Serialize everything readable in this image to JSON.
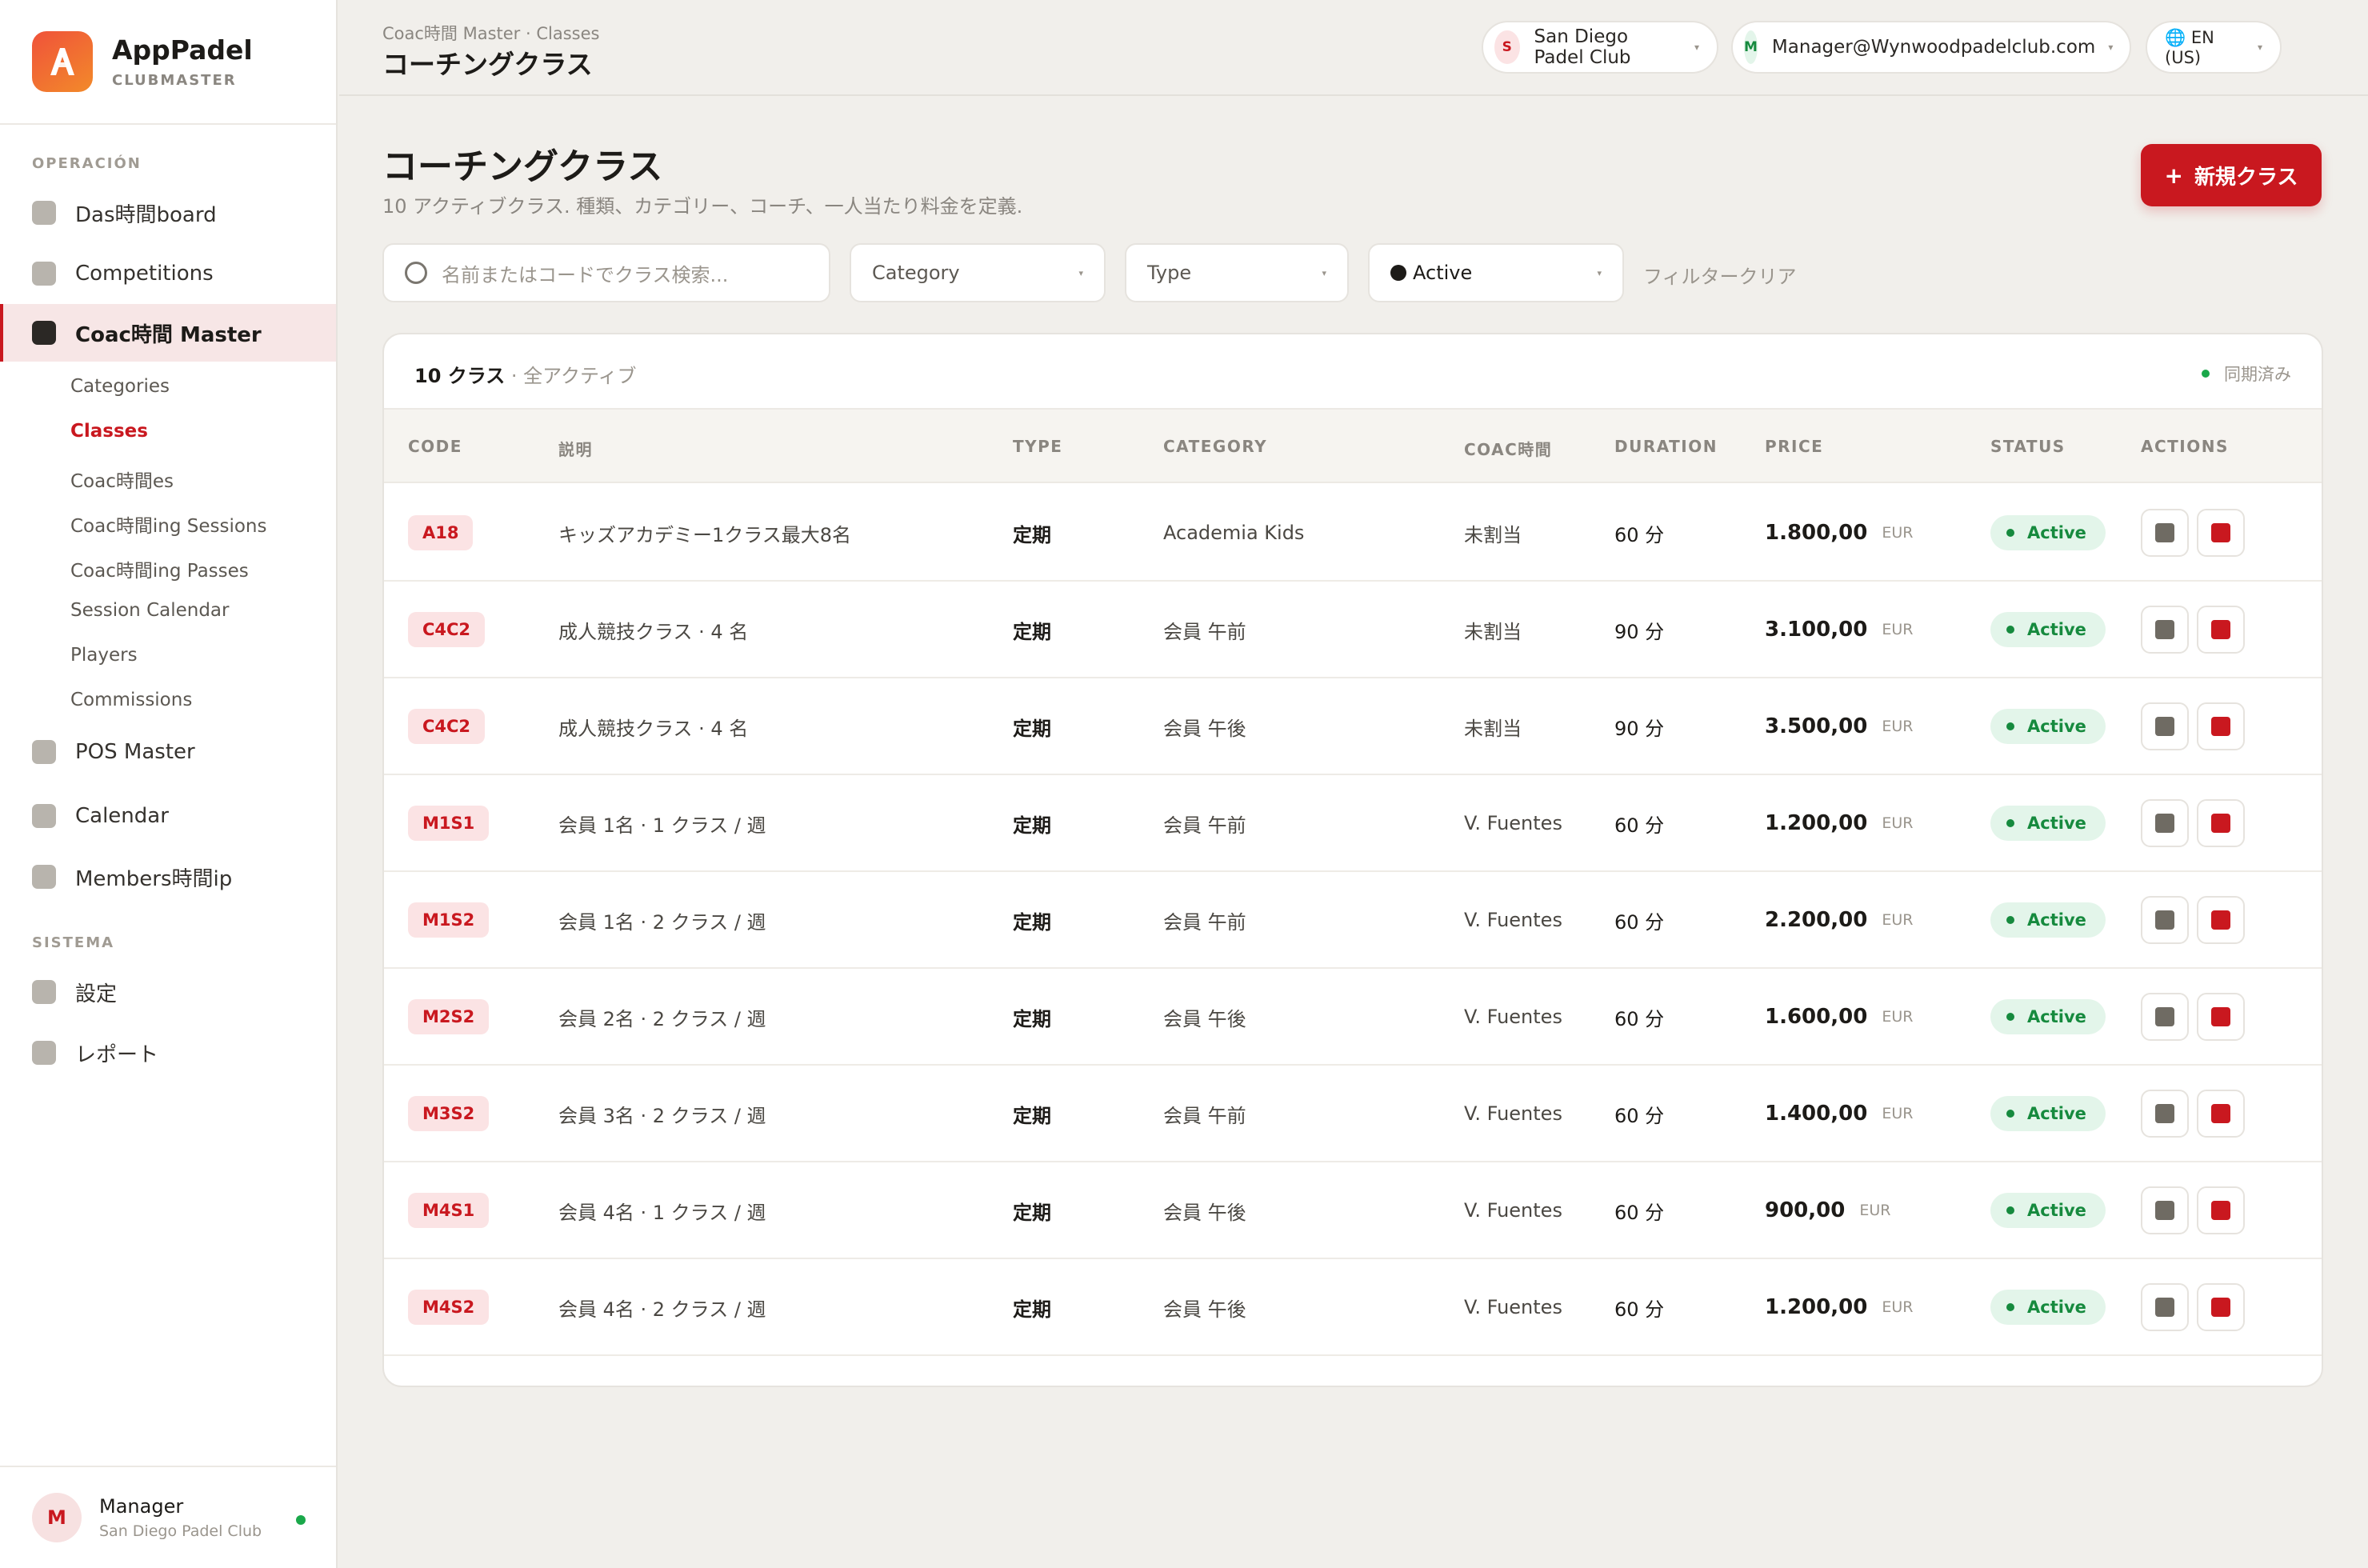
{
  "brand": {
    "name": "AppPadel",
    "sub": "CLUBMASTER"
  },
  "sidebar": {
    "section_operation": "OPERACIÓN",
    "section_system": "SISTEMA",
    "items": [
      {
        "label": "Das時間board"
      },
      {
        "label": "Competitions"
      },
      {
        "label": "Coac時間 Master"
      },
      {
        "label": "POS Master"
      },
      {
        "label": "Calendar"
      },
      {
        "label": "Members時間ip"
      },
      {
        "label": "設定"
      },
      {
        "label": "レポート"
      }
    ],
    "sub_items": [
      {
        "label": "Categories"
      },
      {
        "label": "Classes"
      },
      {
        "label": "Coac時間es"
      },
      {
        "label": "Coac時間ing Sessions"
      },
      {
        "label": "Coac時間ing Passes"
      },
      {
        "label": "Session Calendar"
      },
      {
        "label": "Players"
      },
      {
        "label": "Commissions"
      }
    ]
  },
  "user": {
    "initial": "M",
    "name": "Manager",
    "club": "San Diego Padel Club"
  },
  "topbar": {
    "breadcrumb": "Coac時間 Master · Classes",
    "title": "コーチングクラス",
    "club_initial": "S",
    "club": "San Diego Padel Club",
    "account_initial": "M",
    "account": "Manager@Wynwoodpadelclub.com",
    "language": "🌐 EN (US)"
  },
  "page": {
    "title": "コーチングクラス",
    "subtitle": "10 アクティブクラス. 種類、カテゴリー、コーチ、一人当たり料金を定義.",
    "new_button": "新規クラス"
  },
  "filters": {
    "search_placeholder": "名前またはコードでクラス検索...",
    "category": "Category",
    "type": "Type",
    "status": "Active",
    "clear": "フィルタークリア"
  },
  "table": {
    "count": "10 クラス",
    "count_sub": " · 全アクティブ",
    "sync": "同期済み",
    "headers": [
      "CODE",
      "説明",
      "TYPE",
      "CATEGORY",
      "COAC時間",
      "DURATION",
      "PRICE",
      "STATUS",
      "ACTIONS"
    ],
    "rows": [
      {
        "code": "A18",
        "desc": "キッズアカデミー1クラス最大8名",
        "type": "定期",
        "category": "Academia Kids",
        "coach": "未割当",
        "duration": "60 分",
        "price": "1.800,00",
        "currency": "EUR",
        "status": "Active"
      },
      {
        "code": "C4C2",
        "desc": "成人競技クラス · 4 名",
        "type": "定期",
        "category": "会員 午前",
        "coach": "未割当",
        "duration": "90 分",
        "price": "3.100,00",
        "currency": "EUR",
        "status": "Active"
      },
      {
        "code": "C4C2",
        "desc": "成人競技クラス · 4 名",
        "type": "定期",
        "category": "会員 午後",
        "coach": "未割当",
        "duration": "90 分",
        "price": "3.500,00",
        "currency": "EUR",
        "status": "Active"
      },
      {
        "code": "M1S1",
        "desc": "会員 1名 · 1 クラス / 週",
        "type": "定期",
        "category": "会員 午前",
        "coach": "V. Fuentes",
        "duration": "60 分",
        "price": "1.200,00",
        "currency": "EUR",
        "status": "Active"
      },
      {
        "code": "M1S2",
        "desc": "会員 1名 · 2 クラス / 週",
        "type": "定期",
        "category": "会員 午前",
        "coach": "V. Fuentes",
        "duration": "60 分",
        "price": "2.200,00",
        "currency": "EUR",
        "status": "Active"
      },
      {
        "code": "M2S2",
        "desc": "会員 2名 · 2 クラス / 週",
        "type": "定期",
        "category": "会員 午後",
        "coach": "V. Fuentes",
        "duration": "60 分",
        "price": "1.600,00",
        "currency": "EUR",
        "status": "Active"
      },
      {
        "code": "M3S2",
        "desc": "会員 3名 · 2 クラス / 週",
        "type": "定期",
        "category": "会員 午前",
        "coach": "V. Fuentes",
        "duration": "60 分",
        "price": "1.400,00",
        "currency": "EUR",
        "status": "Active"
      },
      {
        "code": "M4S1",
        "desc": "会員 4名 · 1 クラス / 週",
        "type": "定期",
        "category": "会員 午後",
        "coach": "V. Fuentes",
        "duration": "60 分",
        "price": "900,00",
        "currency": "EUR",
        "status": "Active"
      },
      {
        "code": "M4S2",
        "desc": "会員 4名 · 2 クラス / 週",
        "type": "定期",
        "category": "会員 午後",
        "coach": "V. Fuentes",
        "duration": "60 分",
        "price": "1.200,00",
        "currency": "EUR",
        "status": "Active"
      }
    ]
  },
  "colors": {
    "accent": "#c9181f",
    "success": "#168a3e",
    "background": "#f1efeb"
  },
  "icons": {
    "edit": "square-icon",
    "delete": "trash-icon",
    "search": "search-icon"
  }
}
